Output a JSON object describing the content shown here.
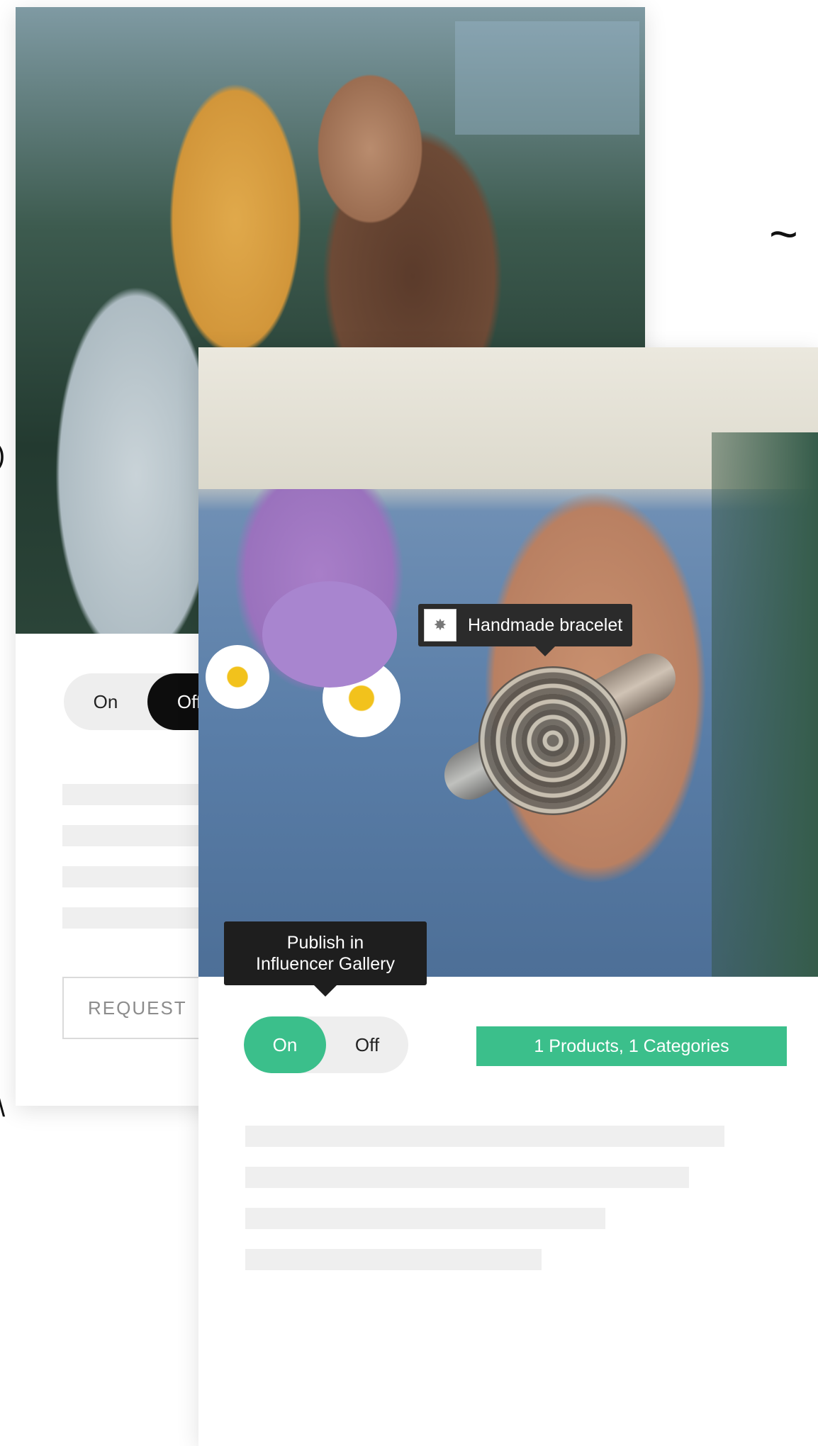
{
  "back_card": {
    "toggle": {
      "on_label": "On",
      "off_label": "Off",
      "selected": "Off"
    },
    "request_button_label": "REQUEST"
  },
  "front_card": {
    "product_tag": {
      "label": "Handmade bracelet",
      "icon": "bracelet-thumbnail-icon"
    },
    "publish_tooltip": {
      "line1": "Publish in",
      "line2": "Influencer Gallery"
    },
    "toggle": {
      "on_label": "On",
      "off_label": "Off",
      "selected": "On"
    },
    "summary_badge": "1 Products, 1 Categories"
  },
  "colors": {
    "accent_green": "#3bbf8b",
    "toggle_off_active": "#0d0d0d",
    "tooltip_bg": "#1e1e1e",
    "placeholder_line": "#efefef"
  }
}
